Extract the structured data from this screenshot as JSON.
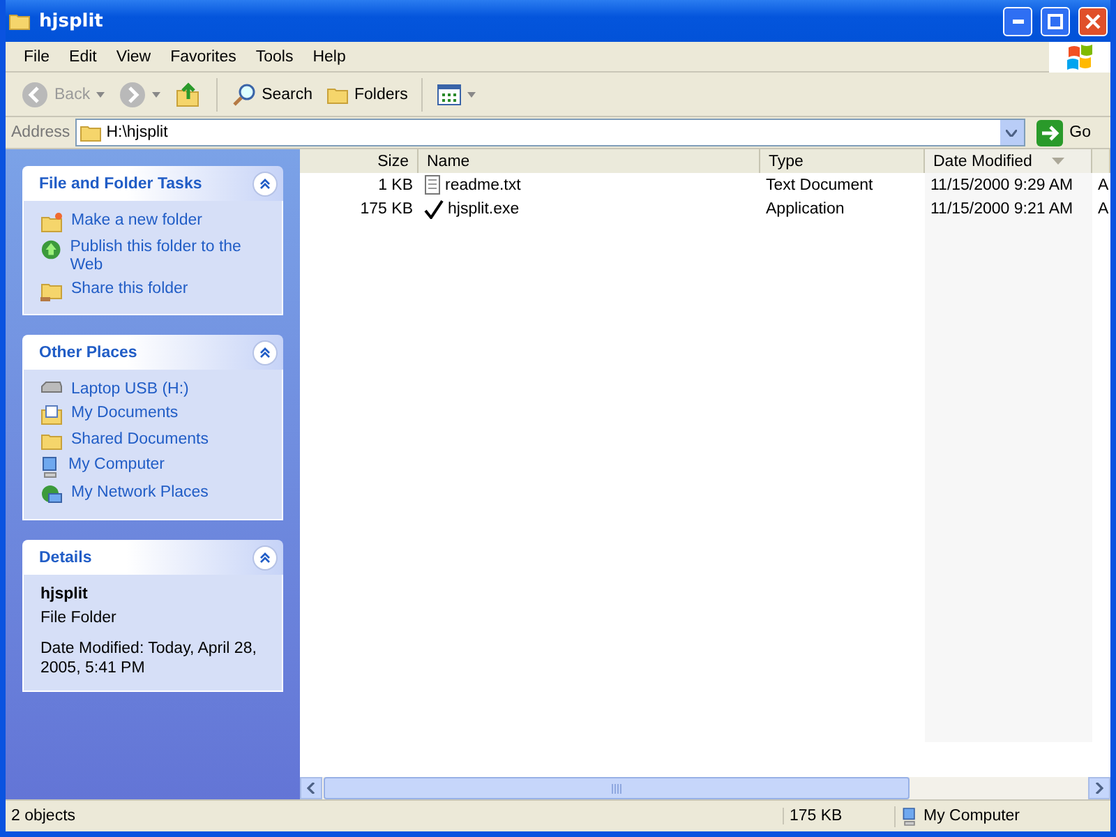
{
  "window": {
    "title": "hjsplit"
  },
  "menu": [
    "File",
    "Edit",
    "View",
    "Favorites",
    "Tools",
    "Help"
  ],
  "toolbar": [
    {
      "kind": "back",
      "label": "Back",
      "disabled": true
    },
    {
      "kind": "forward",
      "disabled": true
    },
    {
      "kind": "up"
    },
    {
      "kind": "search",
      "label": "Search"
    },
    {
      "kind": "folders",
      "label": "Folders"
    },
    {
      "kind": "views"
    }
  ],
  "address": {
    "label": "Address",
    "value": "H:\\hjsplit",
    "go": "Go"
  },
  "panels": [
    {
      "title": "File and Folder Tasks",
      "expanded": true,
      "kind": "links",
      "items": [
        {
          "kind": "newfolder",
          "label": "Make a new folder"
        },
        {
          "kind": "globe",
          "label": "Publish this folder to the Web"
        },
        {
          "kind": "share",
          "label": "Share this folder"
        }
      ]
    },
    {
      "title": "Other Places",
      "expanded": true,
      "kind": "links",
      "items": [
        {
          "kind": "drive",
          "label": "Laptop USB (H:)"
        },
        {
          "kind": "docs",
          "label": "My Documents"
        },
        {
          "kind": "folder",
          "label": "Shared Documents"
        },
        {
          "kind": "computer",
          "label": "My Computer"
        },
        {
          "kind": "network",
          "label": "My Network Places"
        }
      ]
    },
    {
      "title": "Details",
      "expanded": true,
      "kind": "details",
      "name": "hjsplit",
      "type": "File Folder",
      "modified": "Date Modified: Today, April 28, 2005, 5:41 PM"
    }
  ],
  "columns": [
    {
      "label": "Size",
      "sorted": false
    },
    {
      "label": "Name",
      "sorted": false
    },
    {
      "label": "Type",
      "sorted": false
    },
    {
      "label": "Date Modified",
      "sorted": true
    },
    {
      "sorted": false
    }
  ],
  "files": [
    {
      "size": "1 KB",
      "name": "readme.txt",
      "kind": "text",
      "type": "Text Document",
      "modified": "11/15/2000 9:29 AM",
      "column_5": "A"
    },
    {
      "size": "175 KB",
      "name": "hjsplit.exe",
      "kind": "application",
      "type": "Application",
      "modified": "11/15/2000 9:21 AM",
      "column_5": "A"
    }
  ],
  "status_bar": {
    "count": "2 objects",
    "size": "175 KB",
    "zone": "My Computer"
  }
}
